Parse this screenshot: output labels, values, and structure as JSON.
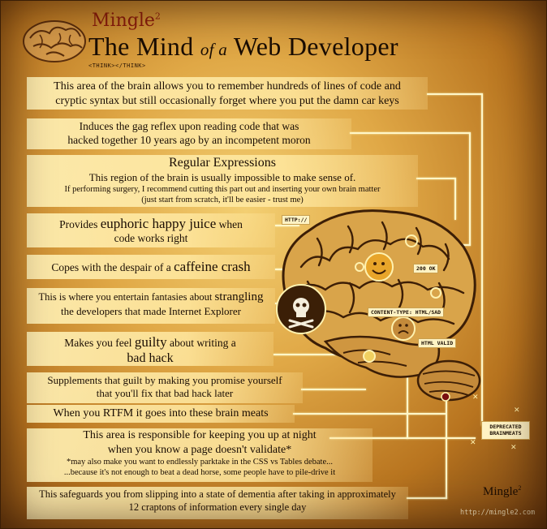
{
  "header": {
    "brand": "Mingle",
    "brand_sup": "2",
    "title_main": "The Mind",
    "title_of": "of a",
    "title_end": "Web Developer",
    "think_tag": "<THINK></THINK>"
  },
  "callouts": {
    "c1": {
      "line1": "This area of the brain allows you to remember hundreds of lines of code and",
      "line2": "cryptic syntax but still occasionally forget where you put the damn car keys"
    },
    "c2": {
      "line1": "Induces the gag reflex upon reading code that was",
      "line2": "hacked together 10 years ago by an incompetent moron"
    },
    "c3": {
      "heading": "Regular Expressions",
      "line1": "This region of the brain is usually impossible to make sense of.",
      "line2": "If performing surgery, I recommend cutting this part out and inserting your own brain matter",
      "line3": "(just start from scratch, it'll be easier - trust me)"
    },
    "c4": {
      "pre": "Provides ",
      "big": "euphoric happy juice",
      "post": " when",
      "line2": "code works right"
    },
    "c5": {
      "pre": "Copes with the despair of a ",
      "big": "caffeine crash"
    },
    "c6": {
      "pre": "This is where you entertain fantasies about ",
      "big": "strangling",
      "line2": "the developers that made Internet Explorer"
    },
    "c7": {
      "pre": "Makes you feel ",
      "big": "guilty",
      "post": " about writing a",
      "line2": "bad hack"
    },
    "c8": {
      "line1": "Supplements that guilt by making you promise yourself",
      "line2": "that you'll fix that bad hack later"
    },
    "c9": {
      "line1": "When you RTFM it goes into these brain meats"
    },
    "c10": {
      "line1": "This area is responsible for keeping you up at night",
      "line2": "when you know a page doesn't validate*",
      "line3": "*may also make you want to endlessly parktake in the CSS vs Tables debate...",
      "line4": "...because it's not enough to beat a dead horse, some people have to pile-drive it"
    },
    "c11": {
      "line1": "This safeguards you from slipping into a state of dementia after taking in approximately",
      "line2": "12 craptons of information every single day"
    }
  },
  "brain_tags": {
    "http": "HTTP://",
    "ok": "200 OK",
    "content_type": "CONTENT-TYPE: HTML/SAD",
    "html_valid": "HTML VALID",
    "deprecated": "DEPRECATED",
    "brainmeats": "BRAINMEATS"
  },
  "footer": {
    "brand": "Mingle",
    "brand_sup": "2",
    "url": "http://mingle2.com"
  },
  "colors": {
    "brand_red": "#8a1c0c",
    "callout_bg": "#fff0b4",
    "connector": "#fff7c9",
    "brain": "#d9a44a"
  }
}
